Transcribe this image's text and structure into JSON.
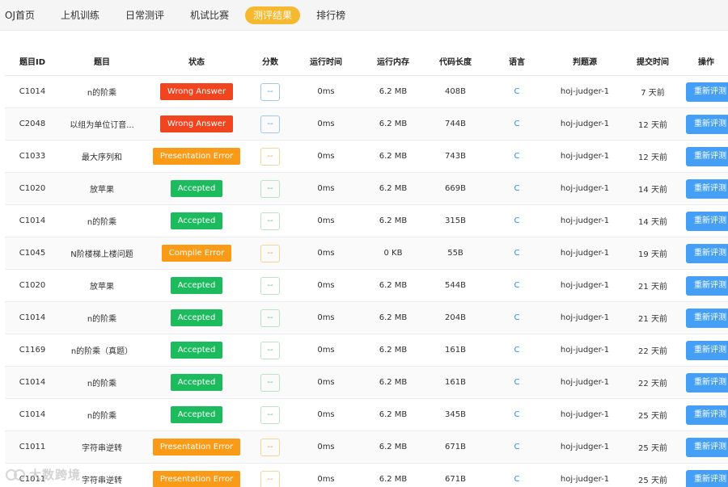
{
  "nav": {
    "items": [
      {
        "label": "OJ首页",
        "active": false
      },
      {
        "label": "上机训练",
        "active": false
      },
      {
        "label": "日常测评",
        "active": false
      },
      {
        "label": "机试比赛",
        "active": false
      },
      {
        "label": "测评结果",
        "active": true
      },
      {
        "label": "排行榜",
        "active": false
      }
    ]
  },
  "table": {
    "headers": [
      "题目ID",
      "题目",
      "状态",
      "分数",
      "运行时间",
      "运行内存",
      "代码长度",
      "语言",
      "判题源",
      "提交时间",
      "操作"
    ],
    "rows": [
      {
        "id": "C1014",
        "title": "n的阶乘",
        "status": "Wrong Answer",
        "status_type": "wa",
        "score": "--",
        "time": "0ms",
        "memory": "6.2 MB",
        "length": "408B",
        "lang": "C",
        "judger": "hoj-judger-1",
        "submit": "7 天前",
        "action": "重新评测"
      },
      {
        "id": "C2048",
        "title": "以组为单位订音...",
        "status": "Wrong Answer",
        "status_type": "wa",
        "score": "--",
        "time": "0ms",
        "memory": "6.2 MB",
        "length": "744B",
        "lang": "C",
        "judger": "hoj-judger-1",
        "submit": "12 天前",
        "action": "重新评测"
      },
      {
        "id": "C1033",
        "title": "最大序列和",
        "status": "Presentation Error",
        "status_type": "pe",
        "score": "--",
        "time": "0ms",
        "memory": "6.2 MB",
        "length": "743B",
        "lang": "C",
        "judger": "hoj-judger-1",
        "submit": "12 天前",
        "action": "重新评测"
      },
      {
        "id": "C1020",
        "title": "放苹果",
        "status": "Accepted",
        "status_type": "ac",
        "score": "--",
        "time": "0ms",
        "memory": "6.2 MB",
        "length": "669B",
        "lang": "C",
        "judger": "hoj-judger-1",
        "submit": "14 天前",
        "action": "重新评测"
      },
      {
        "id": "C1014",
        "title": "n的阶乘",
        "status": "Accepted",
        "status_type": "ac",
        "score": "--",
        "time": "0ms",
        "memory": "6.2 MB",
        "length": "315B",
        "lang": "C",
        "judger": "hoj-judger-1",
        "submit": "14 天前",
        "action": "重新评测"
      },
      {
        "id": "C1045",
        "title": "N阶楼梯上楼问题",
        "status": "Compile Error",
        "status_type": "ce",
        "score": "--",
        "time": "0ms",
        "memory": "0 KB",
        "length": "55B",
        "lang": "C",
        "judger": "hoj-judger-1",
        "submit": "19 天前",
        "action": "重新评测"
      },
      {
        "id": "C1020",
        "title": "放苹果",
        "status": "Accepted",
        "status_type": "ac",
        "score": "--",
        "time": "0ms",
        "memory": "6.2 MB",
        "length": "544B",
        "lang": "C",
        "judger": "hoj-judger-1",
        "submit": "21 天前",
        "action": "重新评测"
      },
      {
        "id": "C1014",
        "title": "n的阶乘",
        "status": "Accepted",
        "status_type": "ac",
        "score": "--",
        "time": "0ms",
        "memory": "6.2 MB",
        "length": "204B",
        "lang": "C",
        "judger": "hoj-judger-1",
        "submit": "21 天前",
        "action": "重新评测"
      },
      {
        "id": "C1169",
        "title": "n的阶乘（真题）",
        "status": "Accepted",
        "status_type": "ac",
        "score": "--",
        "time": "0ms",
        "memory": "6.2 MB",
        "length": "161B",
        "lang": "C",
        "judger": "hoj-judger-1",
        "submit": "22 天前",
        "action": "重新评测"
      },
      {
        "id": "C1014",
        "title": "n的阶乘",
        "status": "Accepted",
        "status_type": "ac",
        "score": "--",
        "time": "0ms",
        "memory": "6.2 MB",
        "length": "161B",
        "lang": "C",
        "judger": "hoj-judger-1",
        "submit": "22 天前",
        "action": "重新评测"
      },
      {
        "id": "C1014",
        "title": "n的阶乘",
        "status": "Accepted",
        "status_type": "ac",
        "score": "--",
        "time": "0ms",
        "memory": "6.2 MB",
        "length": "345B",
        "lang": "C",
        "judger": "hoj-judger-1",
        "submit": "25 天前",
        "action": "重新评测"
      },
      {
        "id": "C1011",
        "title": "字符串逆转",
        "status": "Presentation Error",
        "status_type": "pe",
        "score": "--",
        "time": "0ms",
        "memory": "6.2 MB",
        "length": "671B",
        "lang": "C",
        "judger": "hoj-judger-1",
        "submit": "25 天前",
        "action": "重新评测"
      },
      {
        "id": "C1011",
        "title": "字符串逆转",
        "status": "Presentation Error",
        "status_type": "pe",
        "score": "--",
        "time": "0ms",
        "memory": "6.2 MB",
        "length": "671B",
        "lang": "C",
        "judger": "hoj-judger-1",
        "submit": "25 天前",
        "action": "重新评测"
      }
    ]
  },
  "watermark": {
    "text": "大数跨境",
    "icon": "watermark-logo-icon"
  },
  "colors": {
    "accent": "#f5b82e",
    "wrong_answer": "#f0451f",
    "presentation_error": "#f99b16",
    "accepted": "#1bbb5e",
    "compile_error": "#f99b16",
    "rejudge_button": "#45a0f5",
    "language_link": "#2d8cf0"
  }
}
